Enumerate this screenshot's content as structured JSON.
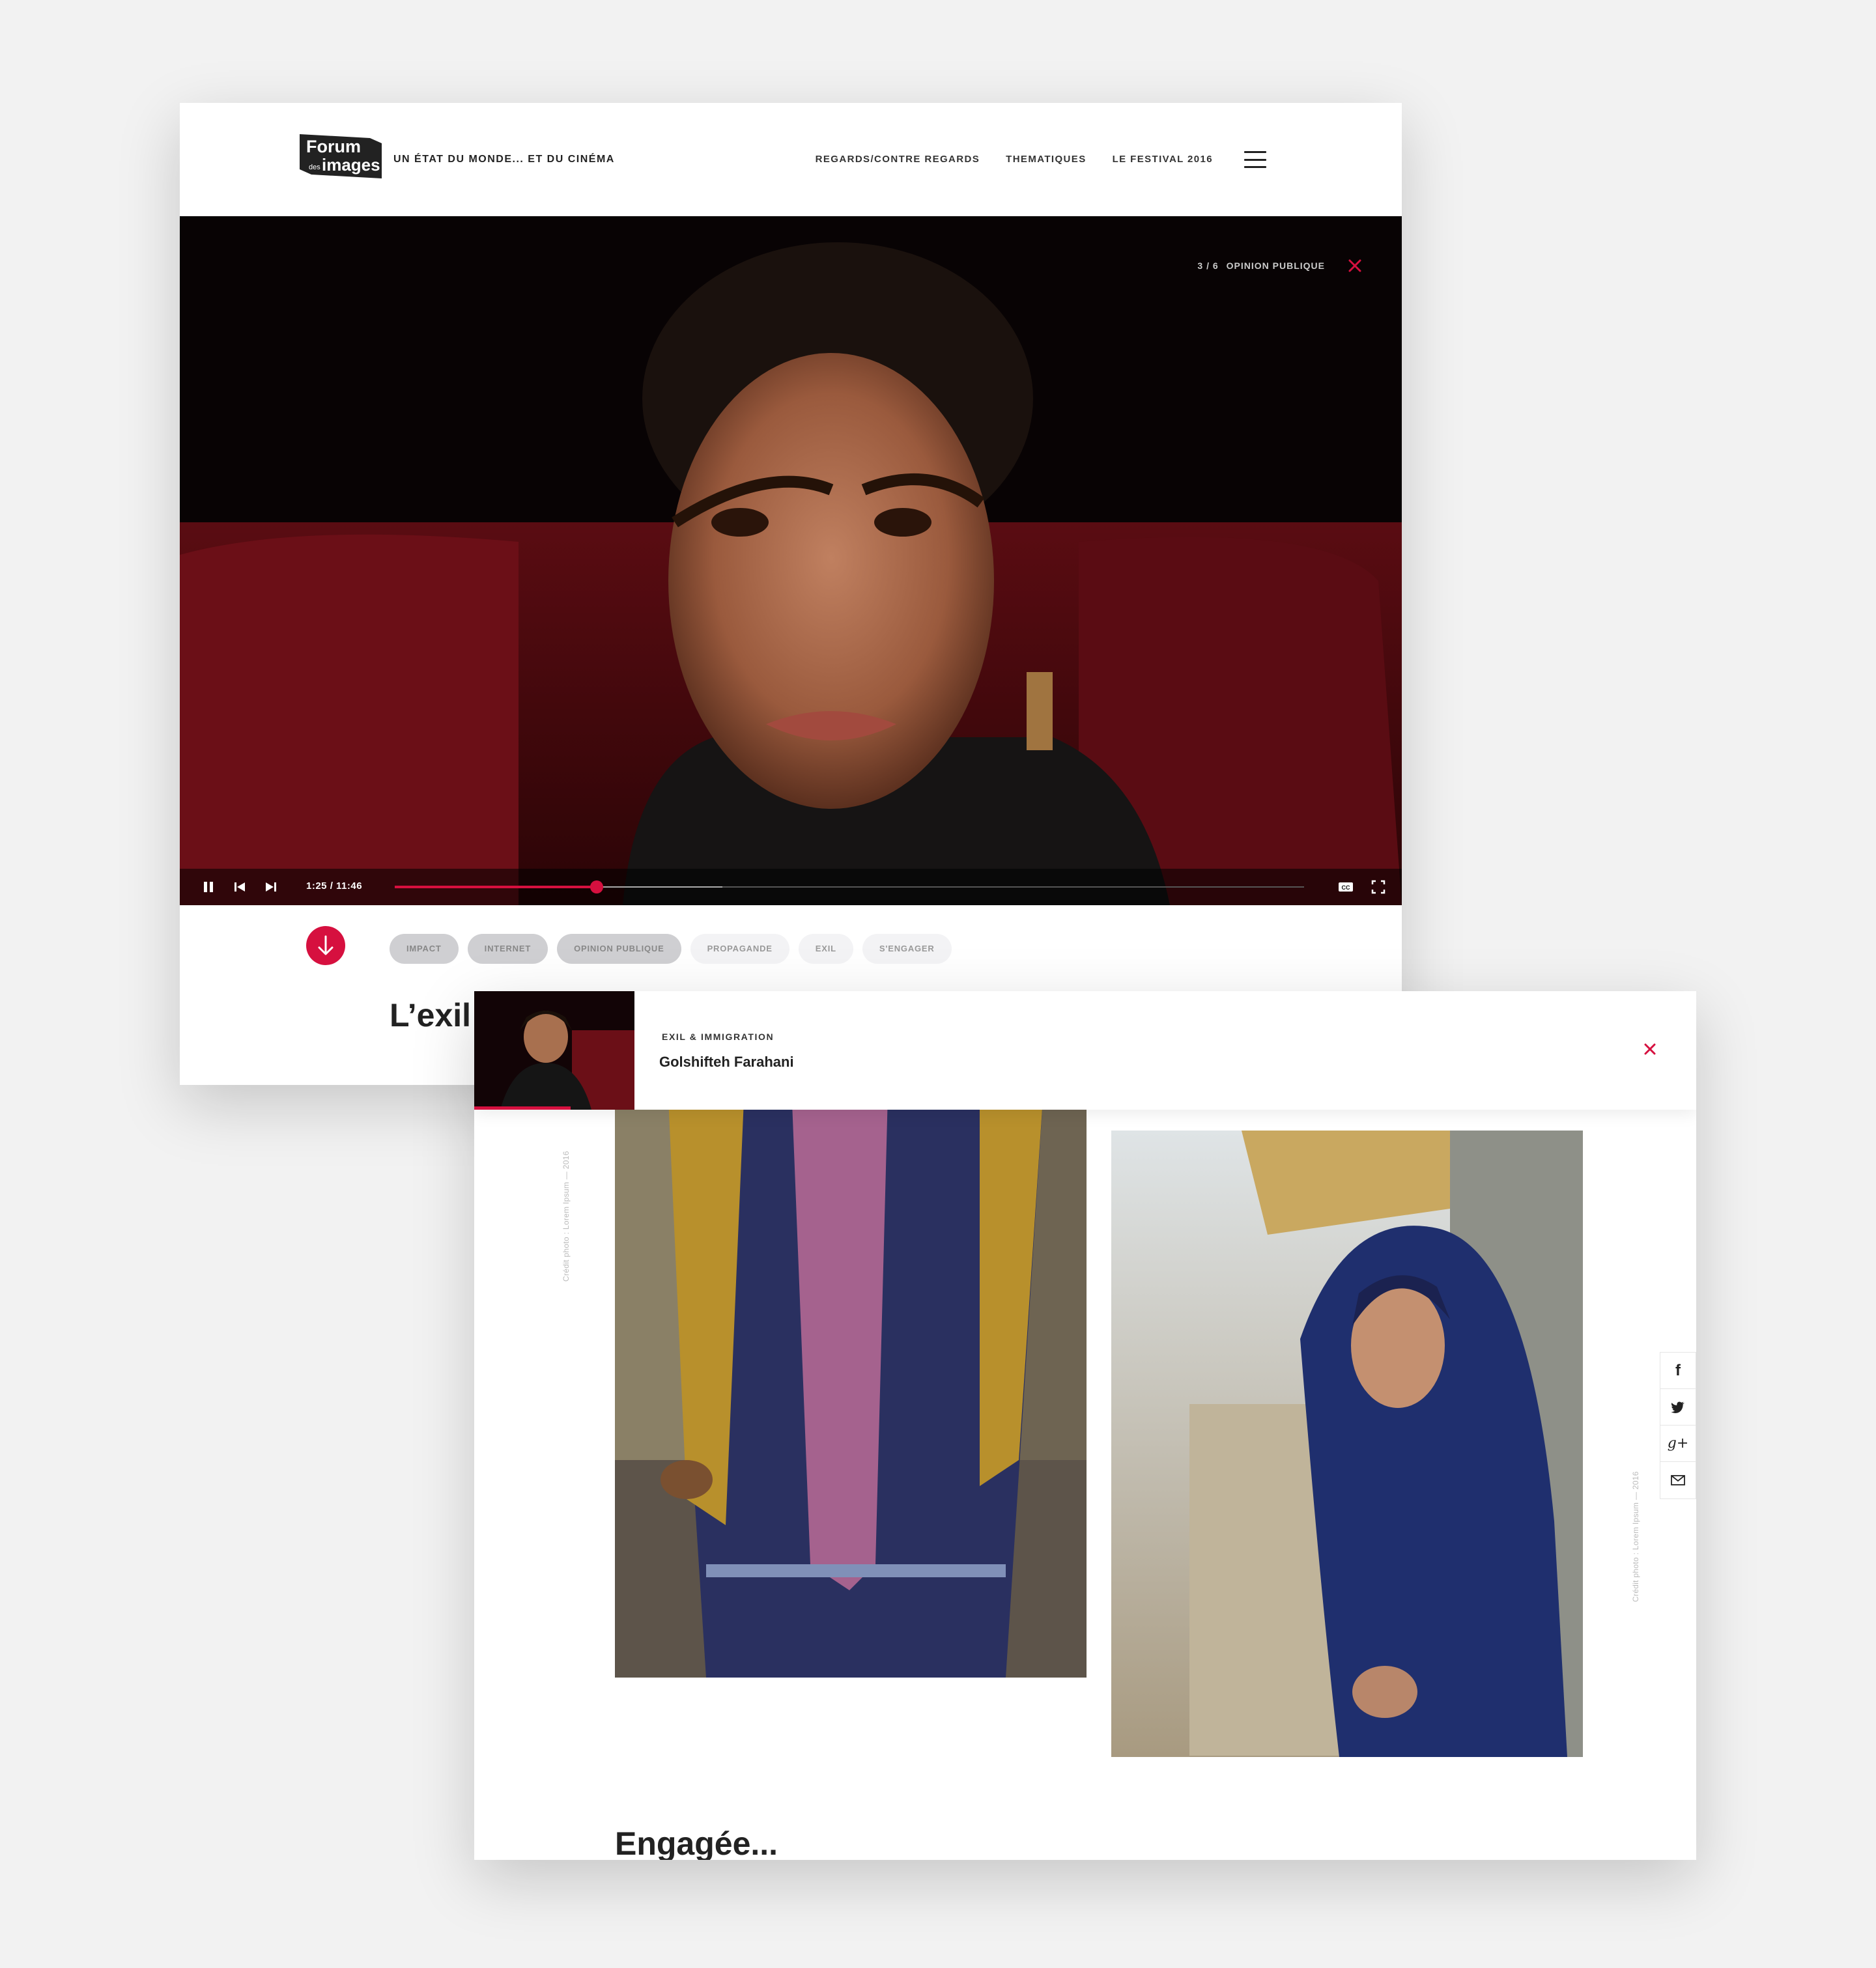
{
  "header": {
    "logo_line1": "Forum",
    "logo_line2": "des",
    "logo_line3": "images",
    "tagline": "UN ÉTAT DU MONDE... ET DU CINÉMA",
    "nav": [
      "REGARDS/CONTRE REGARDS",
      "THEMATIQUES",
      "LE FESTIVAL 2016"
    ]
  },
  "player": {
    "counter": "3 / 6",
    "chapter": "OPINION PUBLIQUE",
    "time": "1:25 / 11:46",
    "progress": 0.222,
    "buffered": 0.36,
    "cc_label": "CC"
  },
  "tags": [
    {
      "label": "IMPACT",
      "active": true
    },
    {
      "label": "INTERNET",
      "active": true
    },
    {
      "label": "OPINION PUBLIQUE",
      "active": true
    },
    {
      "label": "PROPAGANDE",
      "active": false
    },
    {
      "label": "EXIL",
      "active": false
    },
    {
      "label": "S'ENGAGER",
      "active": false
    }
  ],
  "article": {
    "title": "L’exil"
  },
  "mini_player": {
    "category": "EXIL & IMMIGRATION",
    "name": "Golshifteh Farahani",
    "progress": 0.6
  },
  "credits": {
    "photo1": "Crédit photo : Lorem Ipsum — 2016",
    "photo2": "Crédit photo : Lorem Ipsum — 2016"
  },
  "share": [
    "f",
    "g+"
  ],
  "section": {
    "title": "Engagée..."
  },
  "colors": {
    "accent": "#d6103f",
    "background": "#f2f2f2"
  },
  "icons": [
    "hamburger-menu-icon",
    "close-icon",
    "pause-icon",
    "previous-icon",
    "next-icon",
    "closed-captions-icon",
    "fullscreen-icon",
    "arrow-down-icon",
    "facebook-icon",
    "twitter-icon",
    "google-plus-icon",
    "mail-icon"
  ]
}
